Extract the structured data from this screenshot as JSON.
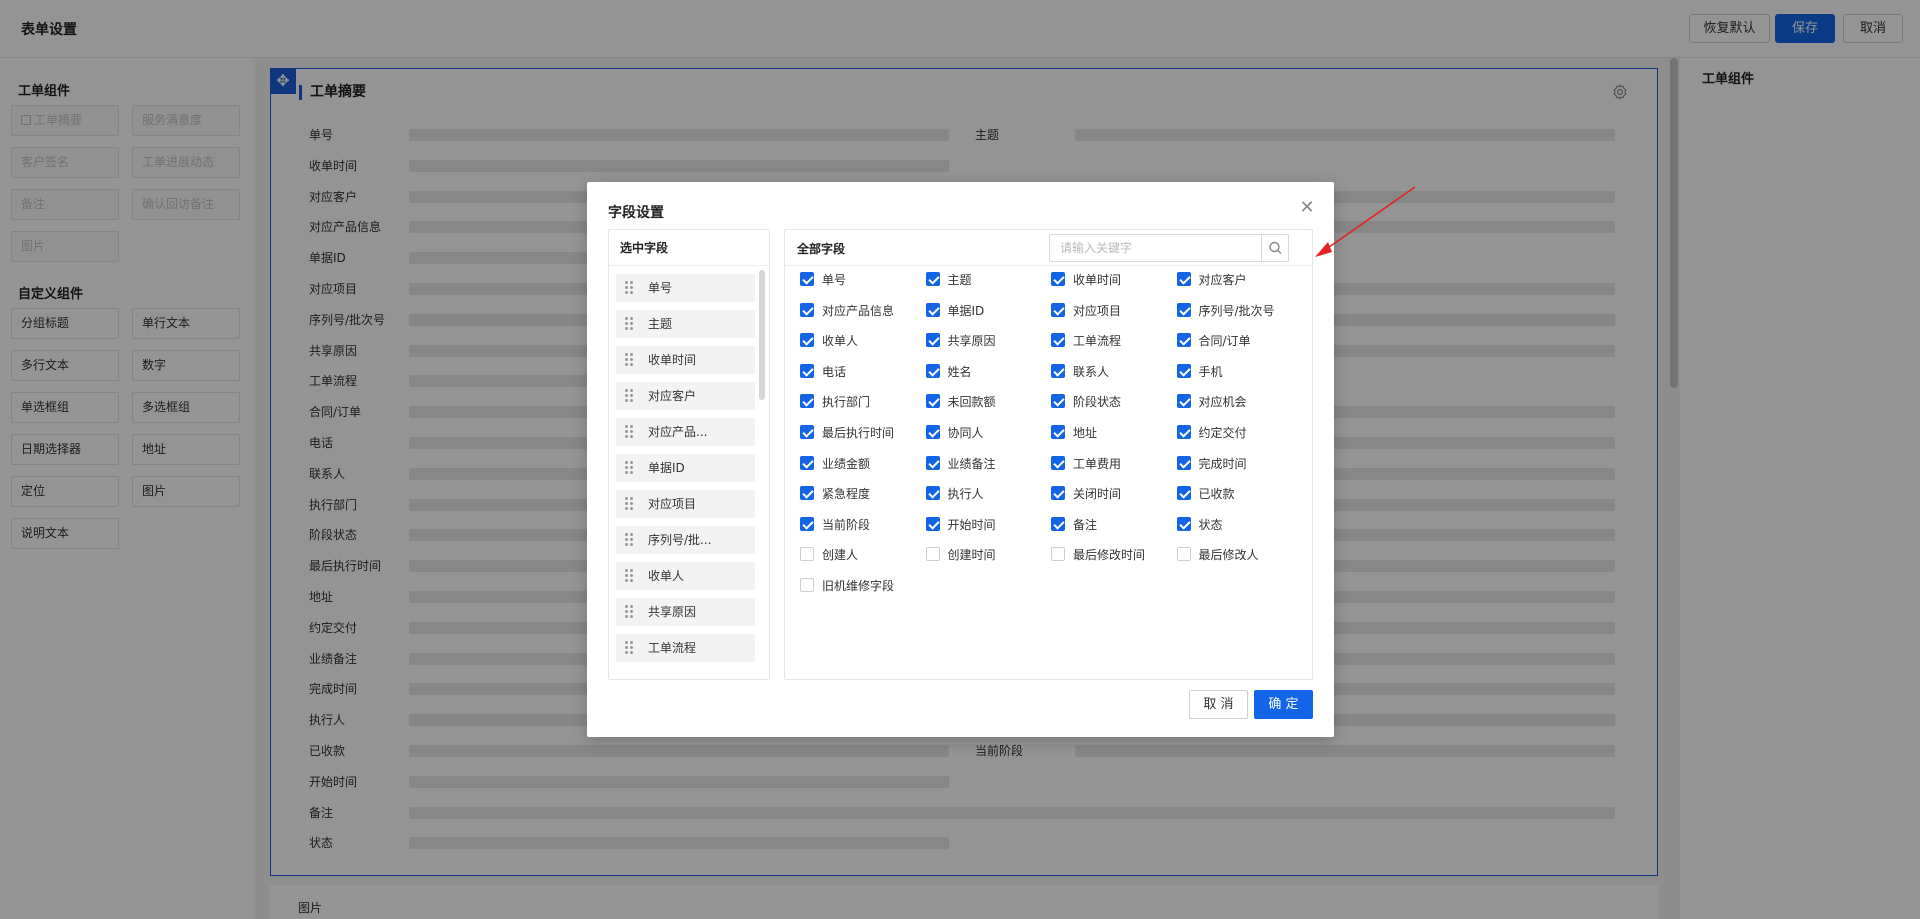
{
  "header": {
    "title": "表单设置",
    "restore_label": "恢复默认",
    "save_label": "保存",
    "cancel_label": "取消"
  },
  "left_panel": {
    "workorder_section_title": "工单组件",
    "workorder_components": [
      "工单摘要",
      "服务满意度",
      "客户签名",
      "工单进展动态",
      "备注",
      "确认回访备注",
      "图片"
    ],
    "custom_section_title": "自定义组件",
    "custom_components": [
      "分组标题",
      "单行文本",
      "多行文本",
      "数字",
      "单选框组",
      "多选框组",
      "日期选择器",
      "地址",
      "定位",
      "图片",
      "说明文本"
    ]
  },
  "canvas": {
    "card_title": "工单摘要",
    "fields": [
      "单号",
      "收单时间",
      "对应客户",
      "对应产品信息",
      "单据ID",
      "对应项目",
      "序列号/批次号",
      "共享原因",
      "工单流程",
      "合同/订单",
      "电话",
      "联系人",
      "执行部门",
      "阶段状态",
      "最后执行时间",
      "地址",
      "约定交付",
      "业绩备注",
      "完成时间",
      "执行人",
      "已收款",
      "开始时间",
      "备注",
      "状态"
    ],
    "right_fields": {
      "row0": "主题",
      "row20": "当前阶段"
    },
    "image_card_label": "图片"
  },
  "right_panel": {
    "title": "工单组件"
  },
  "modal": {
    "title": "字段设置",
    "selected_title": "选中字段",
    "selected_fields": [
      "单号",
      "主题",
      "收单时间",
      "对应客户",
      "对应产品...",
      "单据ID",
      "对应项目",
      "序列号/批...",
      "收单人",
      "共享原因",
      "工单流程"
    ],
    "all_title": "全部字段",
    "search_placeholder": "请输入关键字",
    "all_fields": [
      {
        "label": "单号",
        "checked": true
      },
      {
        "label": "主题",
        "checked": true
      },
      {
        "label": "收单时间",
        "checked": true
      },
      {
        "label": "对应客户",
        "checked": true
      },
      {
        "label": "对应产品信息",
        "checked": true
      },
      {
        "label": "单据ID",
        "checked": true
      },
      {
        "label": "对应项目",
        "checked": true
      },
      {
        "label": "序列号/批次号",
        "checked": true
      },
      {
        "label": "收单人",
        "checked": true
      },
      {
        "label": "共享原因",
        "checked": true
      },
      {
        "label": "工单流程",
        "checked": true
      },
      {
        "label": "合同/订单",
        "checked": true
      },
      {
        "label": "电话",
        "checked": true
      },
      {
        "label": "姓名",
        "checked": true
      },
      {
        "label": "联系人",
        "checked": true
      },
      {
        "label": "手机",
        "checked": true
      },
      {
        "label": "执行部门",
        "checked": true
      },
      {
        "label": "未回款额",
        "checked": true
      },
      {
        "label": "阶段状态",
        "checked": true
      },
      {
        "label": "对应机会",
        "checked": true
      },
      {
        "label": "最后执行时间",
        "checked": true
      },
      {
        "label": "协同人",
        "checked": true
      },
      {
        "label": "地址",
        "checked": true
      },
      {
        "label": "约定交付",
        "checked": true
      },
      {
        "label": "业绩金额",
        "checked": true
      },
      {
        "label": "业绩备注",
        "checked": true
      },
      {
        "label": "工单费用",
        "checked": true
      },
      {
        "label": "完成时间",
        "checked": true
      },
      {
        "label": "紧急程度",
        "checked": true
      },
      {
        "label": "执行人",
        "checked": true
      },
      {
        "label": "关闭时间",
        "checked": true
      },
      {
        "label": "已收款",
        "checked": true
      },
      {
        "label": "当前阶段",
        "checked": true
      },
      {
        "label": "开始时间",
        "checked": true
      },
      {
        "label": "备注",
        "checked": true
      },
      {
        "label": "状态",
        "checked": true
      },
      {
        "label": "创建人",
        "checked": false
      },
      {
        "label": "创建时间",
        "checked": false
      },
      {
        "label": "最后修改时间",
        "checked": false
      },
      {
        "label": "最后修改人",
        "checked": false
      },
      {
        "label": "旧机维修字段",
        "checked": false
      }
    ],
    "cancel_label": "取 消",
    "ok_label": "确 定"
  },
  "colors": {
    "primary": "#1365e8",
    "annotation_arrow": "#e52222"
  }
}
